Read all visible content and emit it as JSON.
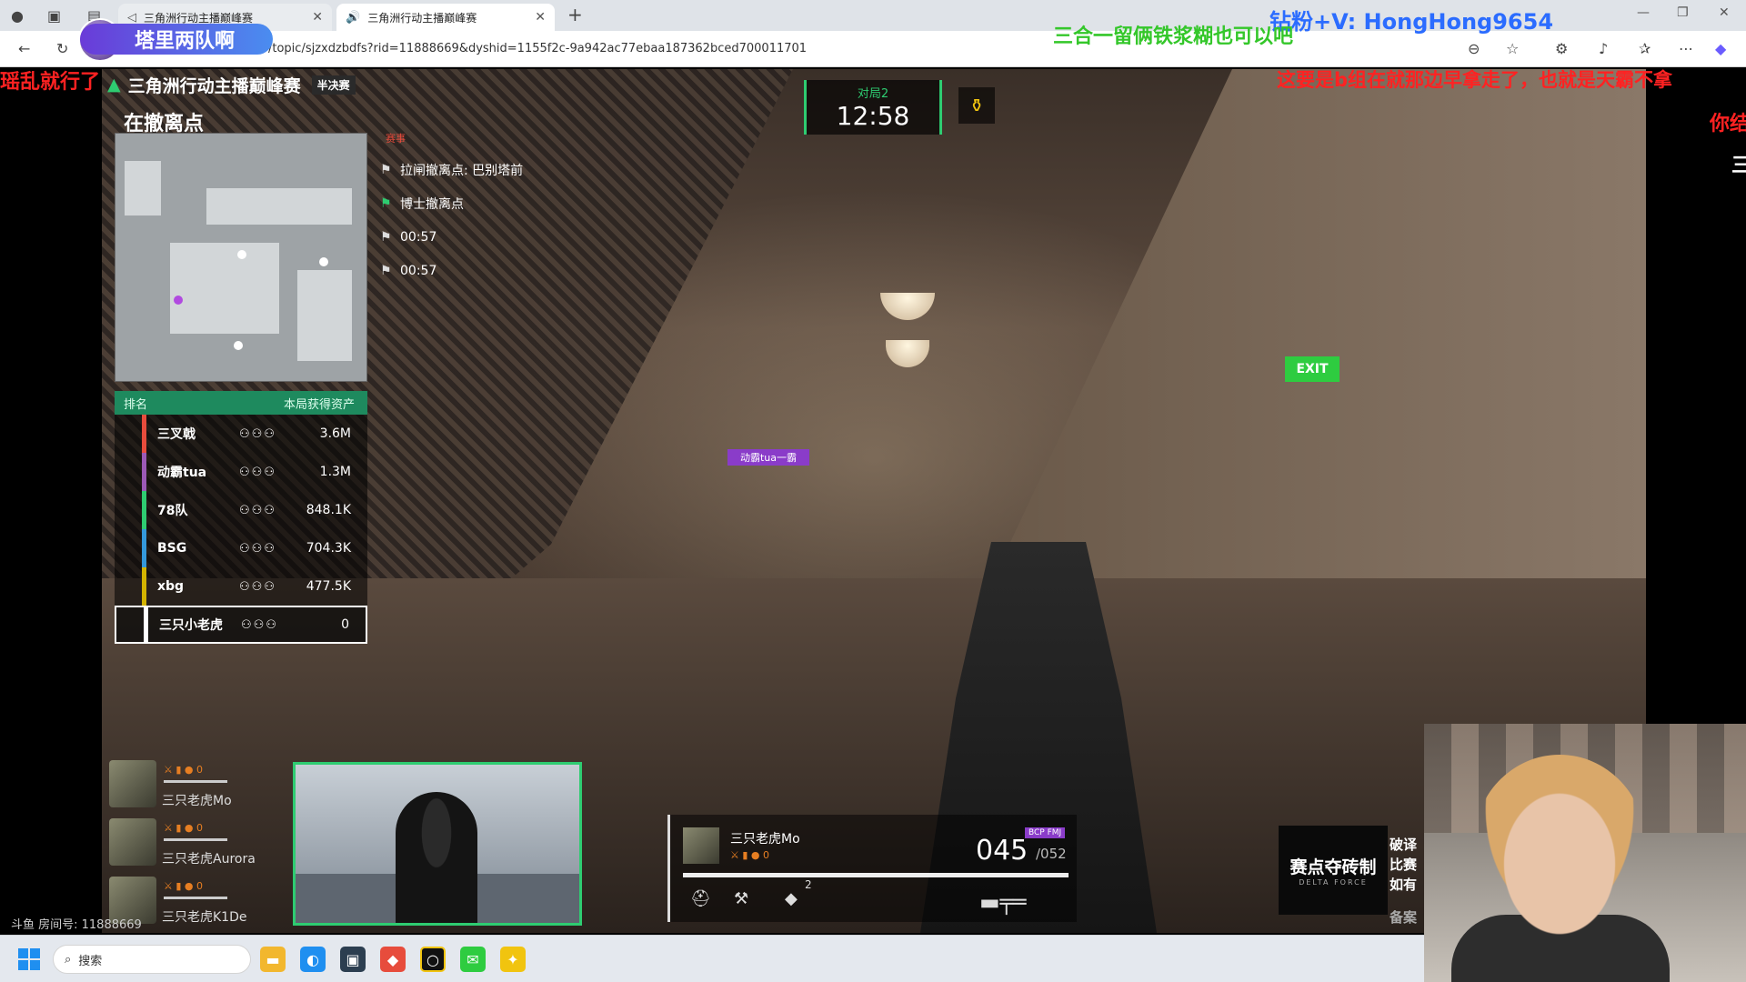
{
  "browser": {
    "tabs": [
      {
        "label": "三角洲行动主播巅峰赛"
      },
      {
        "label": "三角洲行动主播巅峰赛"
      }
    ],
    "url": "/topic/sjzxdzbdfs?rid=11888669&dyshid=1155f2c-9a942ac77ebaa187362bced700011701"
  },
  "streamer": {
    "badge": "塔里两队啊",
    "room_id": "斗鱼 房间号: 11888669"
  },
  "danmaku": [
    {
      "text": "钻粉+V: HongHong9654",
      "color": "#2b6cff"
    },
    {
      "text": "三合一留俩铁浆糊也可以吧",
      "color": "#34c72a"
    },
    {
      "text": "瑶乱就行了",
      "color": "#ff2222"
    },
    {
      "text": "这要是b组在就那边早拿走了，也就是天霸不拿",
      "color": "#ff2222"
    },
    {
      "text": "你结",
      "color": "#ff2222"
    },
    {
      "text": "三",
      "color": "#ffffff"
    }
  ],
  "overlay": {
    "title": "三角洲行动主播巅峰赛",
    "round_tag": "半决赛",
    "status": "在撤离点",
    "feed_head": "赛事",
    "feed": [
      {
        "text": "拉闸撤离点: 巴别塔前"
      },
      {
        "text": "博士撤离点"
      },
      {
        "text": "00:57"
      },
      {
        "text": "00:57"
      }
    ],
    "rank_header": {
      "left": "排名",
      "right": "本局获得资产"
    },
    "teams": [
      {
        "name": "三叉戟",
        "value": "3.6M",
        "color": "#e74c3c"
      },
      {
        "name": "动霸tua",
        "value": "1.3M",
        "color": "#9b59b6"
      },
      {
        "name": "78队",
        "value": "848.1K",
        "color": "#2ecc71"
      },
      {
        "name": "BSG",
        "value": "704.3K",
        "color": "#3498db"
      },
      {
        "name": "xbg",
        "value": "477.5K",
        "color": "#d4b400"
      },
      {
        "name": "三只小老虎",
        "value": "0",
        "color": "#ffffff"
      }
    ],
    "timer": {
      "label": "对局2",
      "time": "12:58"
    },
    "enemy_tag": "动霸tua一霸",
    "exit_sign": "EXIT"
  },
  "team": [
    {
      "name": "三只老虎Mo",
      "stat": "0"
    },
    {
      "name": "三只老虎Aurora",
      "stat": "0"
    },
    {
      "name": "三只老虎K1De",
      "stat": "0"
    }
  ],
  "weapon": {
    "player": "三只老虎Mo",
    "ammo": "045",
    "reserve": "/052",
    "ammo_type": "BCP FMJ",
    "stat": "0",
    "grenade_count": "2"
  },
  "sponsor": {
    "logo": "赛点夺砖制",
    "sub": "DELTA FORCE",
    "lines": [
      "破译",
      "比赛",
      "如有",
      "备案"
    ]
  },
  "taskbar": {
    "search_placeholder": "搜索"
  }
}
